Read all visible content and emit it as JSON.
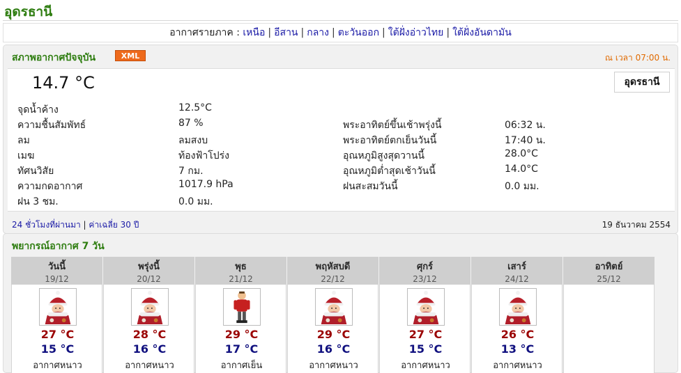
{
  "page": {
    "title": "อุดรธานี"
  },
  "regions": {
    "label": "อากาศรายภาค :",
    "links": [
      "เหนือ",
      "อีสาน",
      "กลาง",
      "ตะวันออก",
      "ใต้ฝั่งอ่าวไทย",
      "ใต้ฝั่งอันดามัน"
    ]
  },
  "current": {
    "section_title": "สภาพอากาศปัจจุบัน",
    "xml_badge": "XML",
    "obs_time": "ณ เวลา 07:00 น.",
    "temperature": "14.7 °C",
    "station": "อุดรธานี",
    "left_rows": [
      {
        "label": "จุดน้ำค้าง",
        "value": "12.5°C"
      },
      {
        "label": "ความชื้นสัมพัทธ์",
        "value": "87 %"
      },
      {
        "label": "ลม",
        "value": "ลมสงบ"
      },
      {
        "label": "เมฆ",
        "value": "ท้องฟ้าโปร่ง"
      },
      {
        "label": "ทัศนวิสัย",
        "value": "7 กม."
      },
      {
        "label": "ความกดอากาศ",
        "value": "1017.9 hPa"
      },
      {
        "label": "ฝน 3 ชม.",
        "value": "0.0 มม."
      }
    ],
    "right_rows": [
      {
        "label": "พระอาทิตย์ขึ้นเช้าพรุ่งนี้",
        "value": "06:32 น."
      },
      {
        "label": "พระอาทิตย์ตกเย็นวันนี้",
        "value": "17:40 น."
      },
      {
        "label": "อุณหภูมิสูงสุดวานนี้",
        "value": "28.0°C"
      },
      {
        "label": "อุณหภูมิต่ำสุดเช้าวันนี้",
        "value": "14.0°C"
      },
      {
        "label": "ฝนสะสมวันนี้",
        "value": "0.0 มม."
      }
    ],
    "footer_link_1": "24 ชั่วโมงที่ผ่านมา",
    "footer_sep": "|",
    "footer_link_2": "ค่าเฉลี่ย 30 ปี",
    "footer_date": "19 ธันวาคม 2554"
  },
  "forecast": {
    "section_title": "พยากรณ์อากาศ 7 วัน",
    "days": [
      {
        "day": "วันนี้",
        "date": "19/12",
        "max": "27 °C",
        "min": "15 °C",
        "desc": "อากาศหนาว",
        "icon": "cold-person-icon"
      },
      {
        "day": "พรุ่งนี้",
        "date": "20/12",
        "max": "28 °C",
        "min": "16 °C",
        "desc": "อากาศหนาว",
        "icon": "cold-person-icon"
      },
      {
        "day": "พุธ",
        "date": "21/12",
        "max": "29 °C",
        "min": "17 °C",
        "desc": "อากาศเย็น",
        "icon": "cool-person-icon"
      },
      {
        "day": "พฤหัสบดี",
        "date": "22/12",
        "max": "29 °C",
        "min": "16 °C",
        "desc": "อากาศหนาว",
        "icon": "cold-person-icon"
      },
      {
        "day": "ศุกร์",
        "date": "23/12",
        "max": "27 °C",
        "min": "15 °C",
        "desc": "อากาศหนาว",
        "icon": "cold-person-icon"
      },
      {
        "day": "เสาร์",
        "date": "24/12",
        "max": "26 °C",
        "min": "13 °C",
        "desc": "อากาศหนาว",
        "icon": "cold-person-icon"
      },
      {
        "day": "อาทิตย์",
        "date": "25/12",
        "max": "",
        "min": "",
        "desc": "",
        "icon": ""
      }
    ]
  },
  "colors": {
    "title_green": "#2e7d10",
    "link_blue": "#1a1aa6",
    "max_red": "#9a0000",
    "min_blue": "#10107f",
    "xml_orange": "#ee6a1c",
    "time_orange": "#e06a00"
  }
}
